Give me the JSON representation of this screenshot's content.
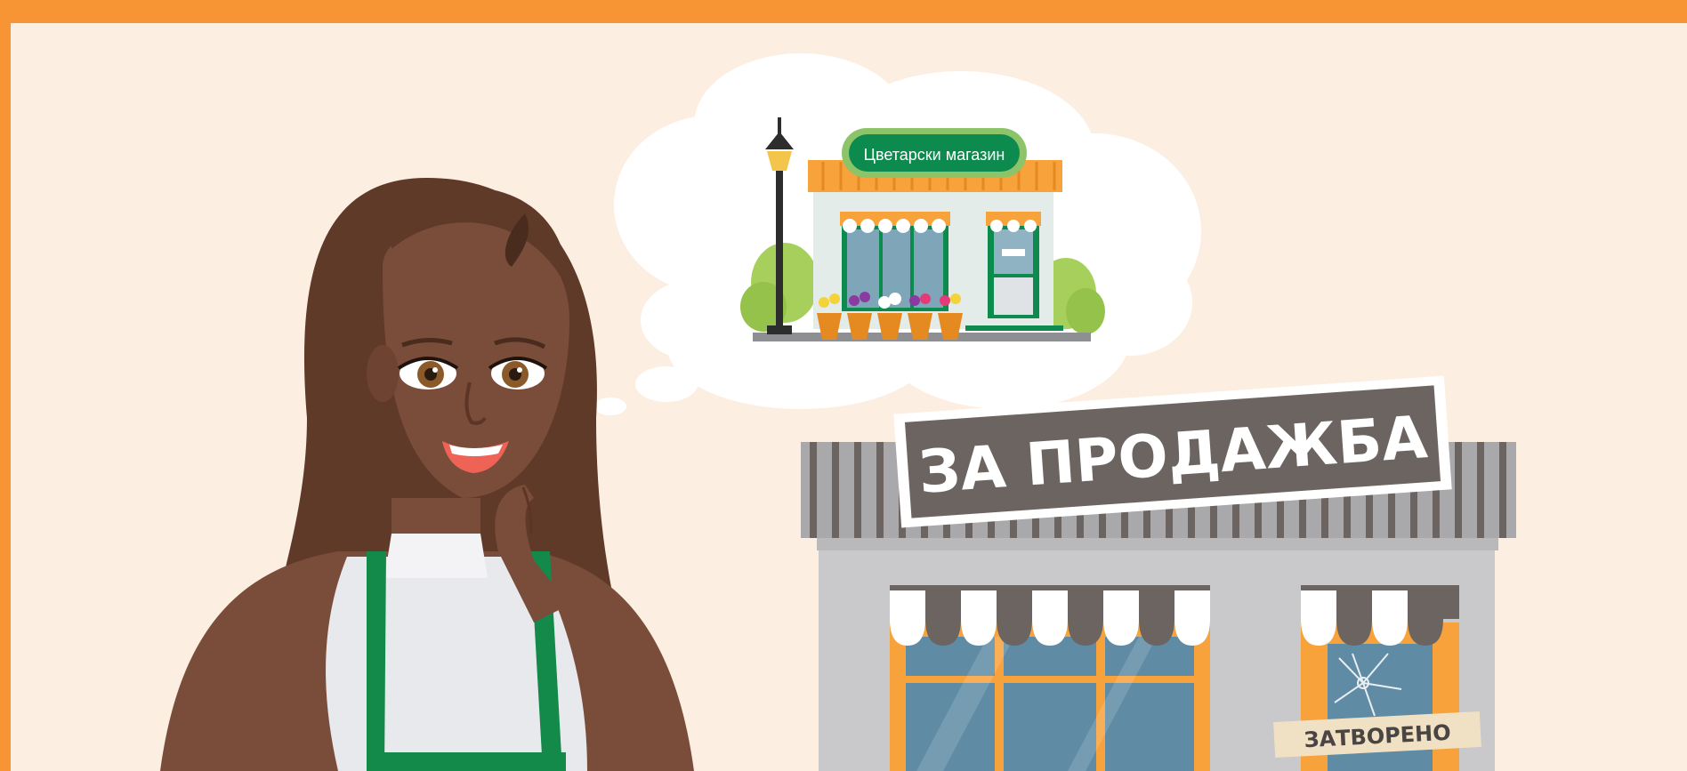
{
  "thought_bubble": {
    "shop_sign": "Цветарски магазин"
  },
  "sale_banner": {
    "text": "ЗА ПРОДАЖБА"
  },
  "closed_sign": {
    "text": "ЗАТВОРЕНО"
  },
  "colors": {
    "frame_orange": "#f79433",
    "background_cream": "#fdeee2",
    "banner_gray": "#6c6461",
    "shop_green": "#0d8a4d",
    "awning_orange": "#f7a23a",
    "building_gray": "#c9c8cb",
    "glass_blue": "#5f8ba5",
    "skin": "#7a4d3a",
    "hair": "#5f3a28",
    "apron_green": "#148a4a"
  }
}
